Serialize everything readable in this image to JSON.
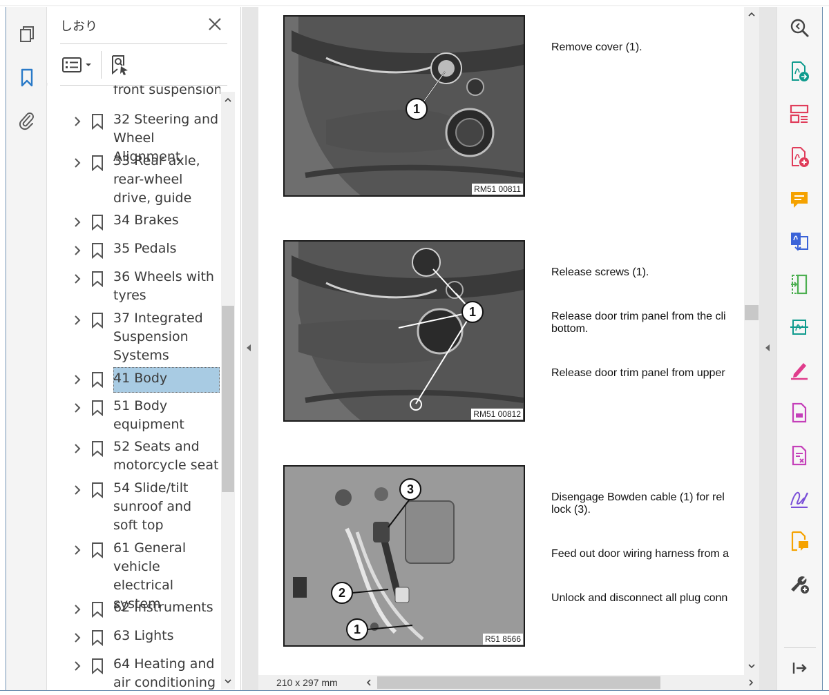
{
  "left_rail": {
    "tools": [
      {
        "name": "pages-thumbnails-icon",
        "color": "#5a5a5a"
      },
      {
        "name": "bookmarks-icon",
        "color": "#2a7ac8"
      },
      {
        "name": "attachments-icon",
        "color": "#5a5a5a"
      }
    ]
  },
  "bookmarks_panel": {
    "title": "しおり",
    "partial_top_item": "front suspension",
    "items": [
      {
        "label": "32 Steering and Wheel Alignment",
        "selected": false
      },
      {
        "label": "33 Rear axle, rear-wheel drive, guide",
        "selected": false
      },
      {
        "label": "34 Brakes",
        "selected": false
      },
      {
        "label": "35 Pedals",
        "selected": false
      },
      {
        "label": "36 Wheels with tyres",
        "selected": false
      },
      {
        "label": "37 Integrated Suspension Systems",
        "selected": false
      },
      {
        "label": "41 Body",
        "selected": true
      },
      {
        "label": "51 Body equipment",
        "selected": false
      },
      {
        "label": "52 Seats and motorcycle seat",
        "selected": false
      },
      {
        "label": "54 Slide/tilt sunroof and soft top",
        "selected": false
      },
      {
        "label": "61 General vehicle electrical system",
        "selected": false
      },
      {
        "label": "62 Instruments",
        "selected": false
      },
      {
        "label": "63 Lights",
        "selected": false
      },
      {
        "label": "64 Heating and air conditioning",
        "selected": false
      }
    ]
  },
  "document": {
    "figures": [
      {
        "code": "RM51 00811",
        "callouts": [
          "1"
        ]
      },
      {
        "code": "RM51 00812",
        "callouts": [
          "1"
        ]
      },
      {
        "code": "R51 8566",
        "callouts": [
          "3",
          "2",
          "1"
        ]
      }
    ],
    "steps": [
      {
        "lines": [
          "Remove cover (1)."
        ]
      },
      {
        "lines": [
          "Release screws (1).",
          "Release door trim panel from the cli\nbottom.",
          "Release door trim panel from upper"
        ]
      },
      {
        "lines": [
          "Disengage Bowden cable (1) for rel\nlock (3).",
          "Feed out door wiring harness from a",
          "Unlock and disconnect all plug conn"
        ]
      }
    ],
    "page_size": "210 x 297 mm"
  },
  "right_tools": [
    {
      "name": "enhance-scan-zoom-icon",
      "color": "#444444"
    },
    {
      "name": "export-pdf-icon",
      "color": "#0f9b8e"
    },
    {
      "name": "organize-pages-icon",
      "color": "#e03c5a"
    },
    {
      "name": "create-pdf-icon",
      "color": "#e03c5a"
    },
    {
      "name": "comment-icon",
      "color": "#f5a200"
    },
    {
      "name": "combine-files-icon",
      "color": "#3b63d8"
    },
    {
      "name": "compress-pdf-icon",
      "color": "#4caf50"
    },
    {
      "name": "scan-ocr-icon",
      "color": "#0f9b8e"
    },
    {
      "name": "fill-sign-icon",
      "color": "#e03c8c"
    },
    {
      "name": "edit-pdf-icon",
      "color": "#c43fb9"
    },
    {
      "name": "redact-icon",
      "color": "#c43fb9"
    },
    {
      "name": "request-signature-icon",
      "color": "#7a4fd8"
    },
    {
      "name": "send-for-comments-icon",
      "color": "#f5a200"
    },
    {
      "name": "more-tools-icon",
      "color": "#444444"
    },
    {
      "name": "collapse-tools-pane-icon",
      "color": "#444444"
    }
  ]
}
